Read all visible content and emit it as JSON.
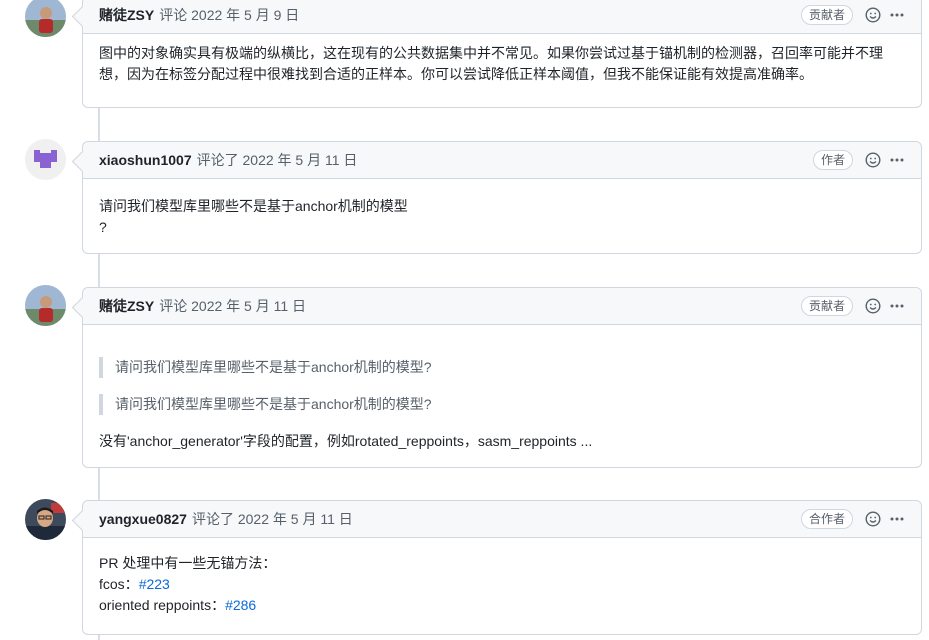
{
  "comments": [
    {
      "author": "赌徒ZSY",
      "meta": "评论 2022 年 5 月 9 日",
      "badge": "贡献者",
      "body": "图中的对象确实具有极端的纵横比，这在现有的公共数据集中并不常见。如果你尝试过基于锚机制的检测器，召回率可能并不理想，因为在标签分配过程中很难找到合适的正样本。你可以尝试降低正样本阈值，但我不能保证能有效提高准确率。"
    },
    {
      "author": "xiaoshun1007",
      "meta": "评论了 2022 年 5 月 11 日",
      "badge": "作者",
      "body_line1": "请问我们模型库里哪些不是基于anchor机制的模型",
      "body_line2": "?"
    },
    {
      "author": "赌徒ZSY",
      "meta": "评论 2022 年 5 月 11 日",
      "badge": "贡献者",
      "quote1": "请问我们模型库里哪些不是基于anchor机制的模型?",
      "quote2": "请问我们模型库里哪些不是基于anchor机制的模型?",
      "body": "没有'anchor_generator'字段的配置，例如rotated_reppoints，sasm_reppoints ..."
    },
    {
      "author": "yangxue0827",
      "meta": "评论了 2022 年 5 月 11 日",
      "badge": "合作者",
      "line1": "PR 处理中有一些无锚方法：",
      "line2_label": "fcos：",
      "line2_link": "#223",
      "line3_label": "oriented reppoints：",
      "line3_link": "#286"
    }
  ],
  "icons": {
    "emoji": "smiley-icon",
    "more": "kebab-horizontal-icon"
  },
  "colors": {
    "link": "#0969da",
    "border": "#d0d7de",
    "header_bg": "#f6f8fa",
    "avatar_purple": "#8a63d2"
  }
}
